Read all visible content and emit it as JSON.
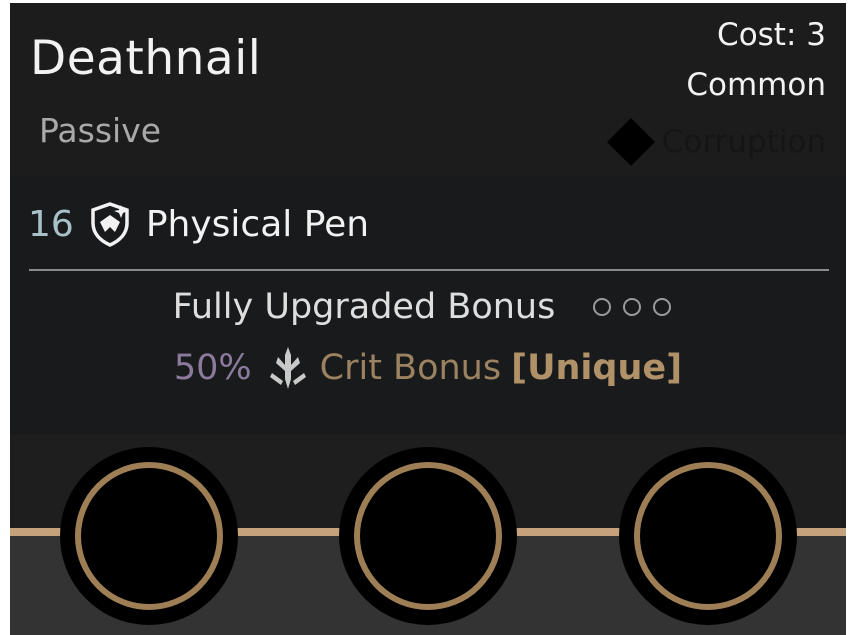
{
  "card": {
    "title": "Deathnail",
    "type": "Passive",
    "cost": "Cost: 3",
    "rarity": "Common",
    "faction": "Corruption",
    "faction_icon": "diamond-faction-icon"
  },
  "stat": {
    "value": "16",
    "label": "Physical Pen",
    "icon": "shield-spark-icon"
  },
  "bonus": {
    "title": "Fully Upgraded Bonus",
    "pips_filled": 0,
    "pips_total": 3,
    "value": "50%",
    "stat": "Crit Bonus",
    "tag": "[Unique]",
    "icon": "crit-dagger-icon"
  },
  "sockets": [
    {
      "filled": false
    },
    {
      "filled": false
    },
    {
      "filled": false
    }
  ],
  "colors": {
    "gold": "#c5a27b",
    "socket_ring": "#9e7e55",
    "bonus_value": "#8c7a9c",
    "stat_value": "#a8c1c9"
  }
}
